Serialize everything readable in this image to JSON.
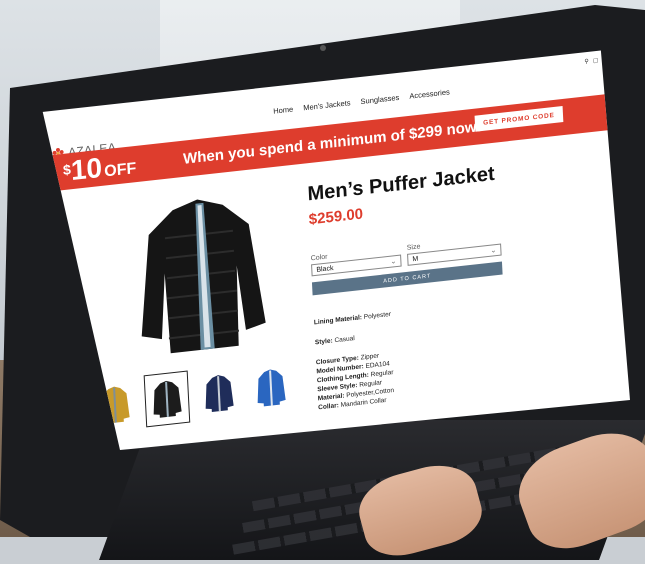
{
  "nav": {
    "items": [
      "Home",
      "Men's Jackets",
      "Sunglasses",
      "Accessories"
    ]
  },
  "header": {
    "logo_text": "AZALEA",
    "icons": [
      "search-icon",
      "bag-icon"
    ]
  },
  "promo": {
    "dollar": "$",
    "amount": "10",
    "off": "OFF",
    "text": "When you spend a minimum of $299 now!",
    "button_label": "GET PROMO CODE",
    "color": "#de3d2d"
  },
  "product": {
    "title": "Men’s Puffer Jacket",
    "price": "$259.00",
    "color_label": "Color",
    "color_value": "Black",
    "size_label": "Size",
    "size_value": "M",
    "add_to_cart_label": "ADD TO CART",
    "thumbnail_colors": [
      "#c89a2a",
      "#1c1c1c",
      "#1f2d5a",
      "#2a66c0"
    ],
    "selected_thumbnail": 1,
    "specs": [
      {
        "label": "Lining Material:",
        "value": "Polyester"
      },
      {
        "label": "Style:",
        "value": "Casual"
      },
      {
        "label": "Closure Type:",
        "value": "Zipper"
      },
      {
        "label": "Model Number:",
        "value": "EDA104"
      },
      {
        "label": "Clothing Length:",
        "value": "Regular"
      },
      {
        "label": "Sleeve Style:",
        "value": "Regular"
      },
      {
        "label": "Material:",
        "value": "Polyester,Cotton"
      },
      {
        "label": "Collar:",
        "value": "Mandarin Collar"
      }
    ]
  },
  "colors": {
    "accent": "#de3d2d",
    "button": "#5a7388"
  }
}
